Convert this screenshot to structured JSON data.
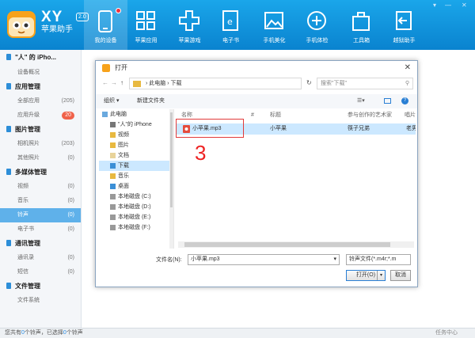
{
  "app": {
    "brand": "XY",
    "version": "2.0",
    "subtitle": "苹果助手"
  },
  "window_controls": [
    "▾",
    "—",
    "✕"
  ],
  "nav": [
    {
      "label": "我的设备",
      "icon": "device-icon",
      "active": true
    },
    {
      "label": "苹果应用",
      "icon": "apps-icon"
    },
    {
      "label": "苹果游戏",
      "icon": "game-icon"
    },
    {
      "label": "电子书",
      "icon": "ebook-icon"
    },
    {
      "label": "手机美化",
      "icon": "image-icon"
    },
    {
      "label": "手机体检",
      "icon": "checkup-icon"
    },
    {
      "label": "工具箱",
      "icon": "toolbox-icon"
    },
    {
      "label": "越狱助手",
      "icon": "jailbreak-icon"
    }
  ],
  "sidebar": {
    "device": "\"人\" 的 iPho...",
    "device_overview": "设备概况",
    "app_mgmt": "应用管理",
    "all_apps": "全部应用",
    "all_apps_count": "(205)",
    "app_update": "应用升级",
    "app_update_badge": "20",
    "photo_mgmt": "图片管理",
    "camera": "相机照片",
    "camera_count": "(203)",
    "other_photos": "其他照片",
    "other_photos_count": "(0)",
    "media_mgmt": "多媒体管理",
    "video": "视频",
    "video_count": "(0)",
    "music": "音乐",
    "music_count": "(0)",
    "ringtone": "铃声",
    "ringtone_count": "(0)",
    "ebook": "电子书",
    "ebook_count": "(0)",
    "comm_mgmt": "通讯管理",
    "contacts": "通讯录",
    "contacts_count": "(0)",
    "sms": "短信",
    "sms_count": "(0)",
    "file_mgmt": "文件管理",
    "filesystem": "文件系统"
  },
  "status": {
    "pre": "您共有",
    "total": "0",
    "mid": "个铃声，已选择",
    "sel": "0",
    "post": "个铃声",
    "tasks": "任务中心"
  },
  "dialog": {
    "title": "打开",
    "close": "✕",
    "path1": "此电脑",
    "path2": "下载",
    "search_placeholder": "搜索\"下载\"",
    "organize": "组织 ▾",
    "new_folder": "新建文件夹",
    "tree": [
      "此电脑",
      "\"人\"的 iPhone",
      "视频",
      "图片",
      "文档",
      "下载",
      "音乐",
      "桌面",
      "本地磁盘 (C:)",
      "本地磁盘 (D:)",
      "本地磁盘 (E:)",
      "本地磁盘 (F:)"
    ],
    "cols": {
      "name": "名称",
      "num": "#",
      "title": "标题",
      "artist": "参与创作的艺术家",
      "album": "唱片"
    },
    "file": {
      "name": "小苹果.mp3",
      "title": "小苹果",
      "artist": "筷子兄弟",
      "album": "老男"
    },
    "annotation": "3",
    "filename_label": "文件名(N):",
    "filename_value": "小苹果.mp3",
    "filetype": "铃声文件(*.m4r;*.m",
    "open": "打开(O)",
    "cancel": "取消"
  }
}
